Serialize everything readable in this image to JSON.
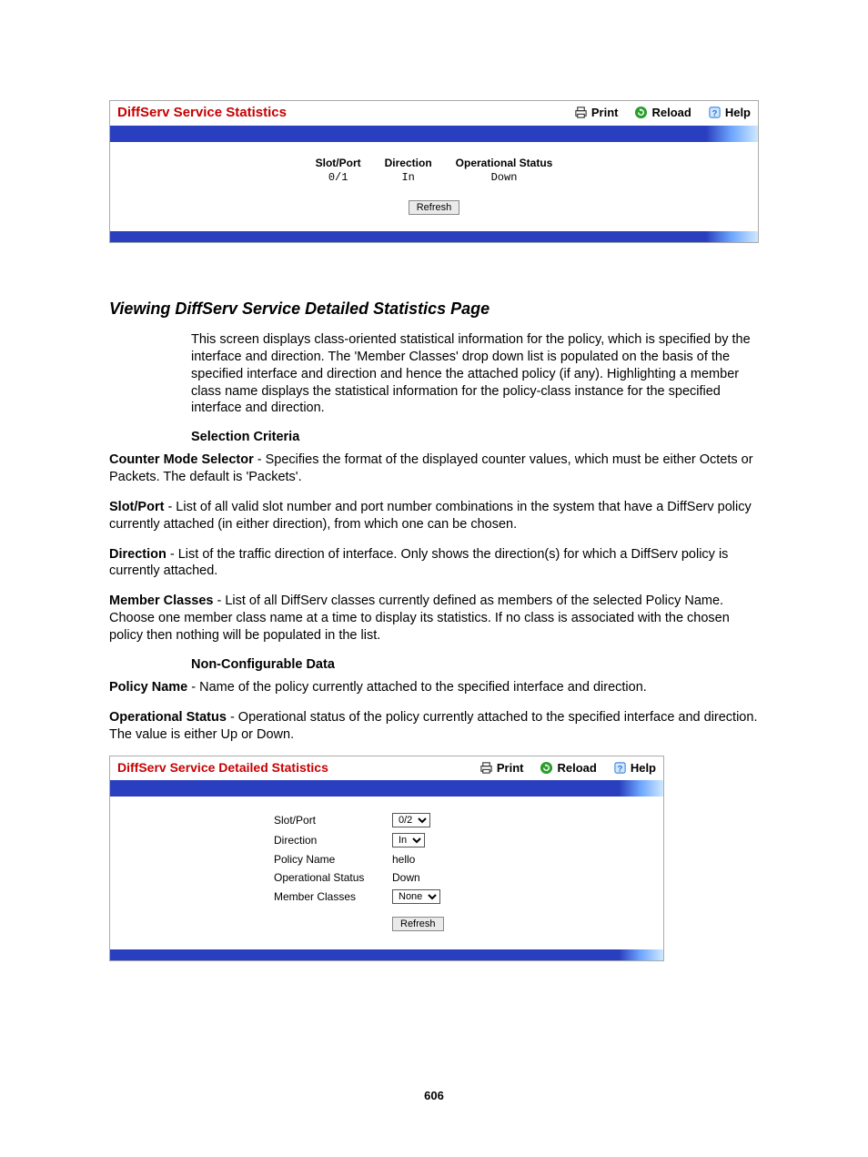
{
  "panel1": {
    "title": "DiffServ Service Statistics",
    "actions": {
      "print": "Print",
      "reload": "Reload",
      "help": "Help"
    },
    "cols": {
      "slotport_h": "Slot/Port",
      "slotport_v": "0/1",
      "direction_h": "Direction",
      "direction_v": "In",
      "opstatus_h": "Operational Status",
      "opstatus_v": "Down"
    },
    "refresh": "Refresh"
  },
  "section": {
    "heading": "Viewing DiffServ Service Detailed Statistics Page",
    "intro": "This screen displays class-oriented statistical information for the policy, which is specified by the interface and direction. The 'Member Classes' drop down list is populated on the basis of the specified interface and direction and hence the attached policy (if any). Highlighting a member class name displays the statistical information for the policy-class instance for the specified interface and direction.",
    "selcrit": "Selection Criteria",
    "counter_b": "Counter Mode Selector",
    "counter_t": " - Specifies the format of the displayed counter values, which must be either Octets or Packets. The default is 'Packets'.",
    "slotport_b": "Slot/Port",
    "slotport_t": " - List of all valid slot number and port number combinations in the system that have a DiffServ policy currently attached (in either direction), from which one can be chosen.",
    "direction_b": "Direction",
    "direction_t": " - List of the traffic direction of interface. Only shows the direction(s) for which a DiffServ policy is currently attached.",
    "member_b": "Member Classes",
    "member_t": " - List of all DiffServ classes currently defined as members of the selected Policy Name. Choose one member class name at a time to display its statistics. If no class is associated with the chosen policy then nothing will be populated in the list.",
    "noncfg": "Non-Configurable Data",
    "policy_b": "Policy Name",
    "policy_t": " - Name of the policy currently attached to the specified interface and direction.",
    "op_b": "Operational Status",
    "op_t": " - Operational status of the policy currently attached to the specified interface and direction. The value is either Up or Down."
  },
  "panel2": {
    "title": "DiffServ Service Detailed Statistics",
    "actions": {
      "print": "Print",
      "reload": "Reload",
      "help": "Help"
    },
    "rows": {
      "slotport_l": "Slot/Port",
      "slotport_v": "0/2",
      "direction_l": "Direction",
      "direction_v": "In",
      "policy_l": "Policy Name",
      "policy_v": "hello",
      "op_l": "Operational Status",
      "op_v": "Down",
      "member_l": "Member Classes",
      "member_v": "None"
    },
    "refresh": "Refresh"
  },
  "pagenum": "606"
}
